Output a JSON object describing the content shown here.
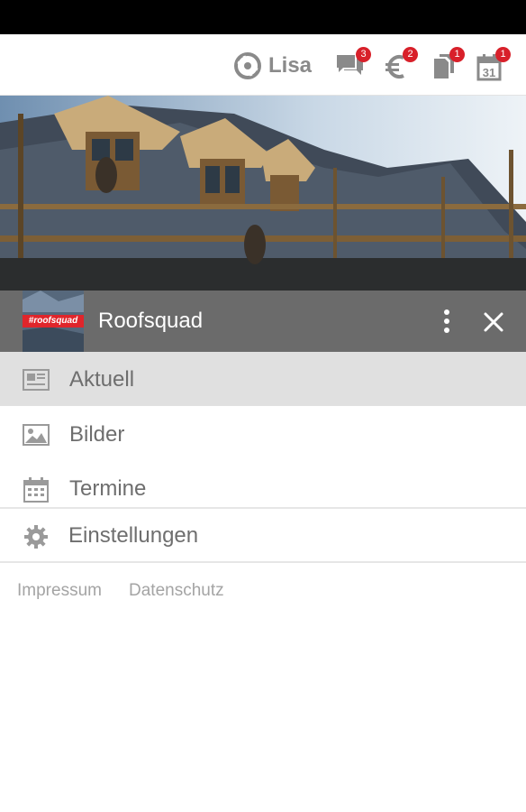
{
  "user": {
    "name": "Lisa",
    "logo_icon": "club-logo-icon"
  },
  "toolbar": [
    {
      "icon": "chat-icon",
      "badge": "3"
    },
    {
      "icon": "euro-icon",
      "badge": "2"
    },
    {
      "icon": "documents-icon",
      "badge": "1"
    },
    {
      "icon": "calendar-icon",
      "badge": "1"
    }
  ],
  "group": {
    "name": "Roofsquad",
    "thumb_tag": "#roofsquad"
  },
  "nav": {
    "items": [
      {
        "label": "Aktuell",
        "icon": "news-icon",
        "active": true
      },
      {
        "label": "Bilder",
        "icon": "image-icon",
        "active": false
      },
      {
        "label": "Termine",
        "icon": "calendar-icon",
        "active": false
      }
    ],
    "settings": {
      "label": "Einstellungen",
      "icon": "gear-icon"
    }
  },
  "footer": {
    "impressum": "Impressum",
    "datenschutz": "Datenschutz"
  },
  "colors": {
    "badge": "#d8202a",
    "group_bar": "#6b6b6b",
    "active_item": "#e0e0e0",
    "icon_gray": "#8a8a8a"
  }
}
